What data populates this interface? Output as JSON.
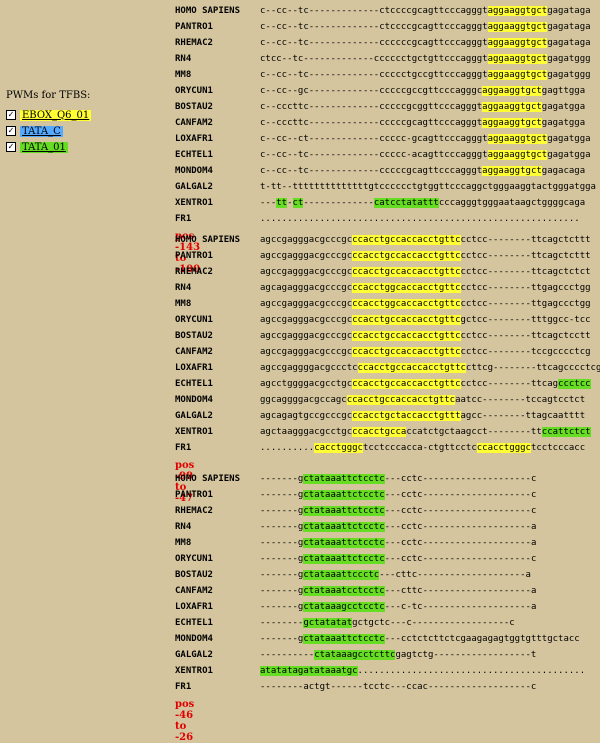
{
  "colors": {
    "background": "#d4c59e",
    "ebox": "#ffff33",
    "tata_c": "#55aaff",
    "tata_01": "#66dd22",
    "position_text": "#e00000"
  },
  "pwm_panel": {
    "title": "PWMs for TFBS:",
    "items": [
      {
        "label": "EBOX_Q6_01",
        "checked": true,
        "color": "#ffff33"
      },
      {
        "label": "TATA_C",
        "checked": true,
        "color": "#55aaff"
      },
      {
        "label": "TATA_01",
        "checked": true,
        "color": "#66dd22"
      }
    ]
  },
  "blocks": [
    {
      "rows": [
        {
          "species": "HOMO SAPIENS",
          "segs": [
            [
              "c--cc--tc-------------ctccccgcagttcccagggt",
              ""
            ],
            [
              "aggaaggtgct",
              "y"
            ],
            [
              "gagataga",
              ""
            ]
          ]
        },
        {
          "species": "PANTRO1",
          "segs": [
            [
              "c--cc--tc-------------ctccccgcagttcccagggt",
              ""
            ],
            [
              "aggaaggtgct",
              "y"
            ],
            [
              "gagataga",
              ""
            ]
          ]
        },
        {
          "species": "RHEMAC2",
          "segs": [
            [
              "c--cc--tc-------------ccccccgcagttcccagggt",
              ""
            ],
            [
              "aggaaggtgct",
              "y"
            ],
            [
              "gagataga",
              ""
            ]
          ]
        },
        {
          "species": "RN4",
          "segs": [
            [
              "ctcc--tc-------------cccccctgctgttcccagggt",
              ""
            ],
            [
              "aggaaggtgct",
              "y"
            ],
            [
              "gagatggg",
              ""
            ]
          ]
        },
        {
          "species": "MM8",
          "segs": [
            [
              "c--cc--tc-------------ccccctgccgttcccagggt",
              ""
            ],
            [
              "aggaaggtgct",
              "y"
            ],
            [
              "gagatggg",
              ""
            ]
          ]
        },
        {
          "species": "ORYCUN1",
          "segs": [
            [
              "c--cc--gc-------------cccccgccgttcccagggc",
              ""
            ],
            [
              "aggaaggtgct",
              "y"
            ],
            [
              "gagttgga",
              ""
            ]
          ]
        },
        {
          "species": "BOSTAU2",
          "segs": [
            [
              "c--cccttc-------------cccccgcggttcccagggt",
              ""
            ],
            [
              "aggaaggtgct",
              "y"
            ],
            [
              "gagatgga",
              ""
            ]
          ]
        },
        {
          "species": "CANFAM2",
          "segs": [
            [
              "c--cccttc-------------cccccgcagttcccagggt",
              ""
            ],
            [
              "aggaaggtgct",
              "y"
            ],
            [
              "gagatgga",
              ""
            ]
          ]
        },
        {
          "species": "LOXAFR1",
          "segs": [
            [
              "c--cc--ct-------------ccccc-gcagttcccagggt",
              ""
            ],
            [
              "aggaaggtgct",
              "y"
            ],
            [
              "gagatgga",
              ""
            ]
          ]
        },
        {
          "species": "ECHTEL1",
          "segs": [
            [
              "c--cc--tc-------------ccccc-acagttcccagggt",
              ""
            ],
            [
              "aggaaggtgct",
              "y"
            ],
            [
              "gagatgga",
              ""
            ]
          ]
        },
        {
          "species": "MONDOM4",
          "segs": [
            [
              "c--cc--tc-------------cccccgcagttcccagggt",
              ""
            ],
            [
              "aggaaggtgct",
              "y"
            ],
            [
              "gagacaga",
              ""
            ]
          ]
        },
        {
          "species": "GALGAL2",
          "segs": [
            [
              "t-tt--ttttttttttttttgtcccccctgtggttcccaggctgggaaggtactgggatgga",
              ""
            ]
          ]
        },
        {
          "species": "XENTRO1",
          "segs": [
            [
              "---",
              ""
            ],
            [
              "tt",
              "g"
            ],
            [
              "-",
              ""
            ],
            [
              "ct",
              "g"
            ],
            [
              "-------------",
              ""
            ],
            [
              "catcctatattt",
              "g"
            ],
            [
              "cccagggtgggaataagctggggcaga",
              ""
            ]
          ]
        },
        {
          "species": "FR1",
          "segs": [
            [
              "...........................................................",
              ""
            ]
          ]
        }
      ],
      "pos": "pos -143 to -100"
    },
    {
      "rows": [
        {
          "species": "HOMO SAPIENS",
          "segs": [
            [
              "agccgagggacgcccgc",
              ""
            ],
            [
              "ccacctgccaccacctgttc",
              "y"
            ],
            [
              "cctcc--------ttcagctcttt",
              ""
            ]
          ]
        },
        {
          "species": "PANTRO1",
          "segs": [
            [
              "agccgagggacgcccgc",
              ""
            ],
            [
              "ccacctgccaccacctgttc",
              "y"
            ],
            [
              "cctcc--------ttcagctcttt",
              ""
            ]
          ]
        },
        {
          "species": "RHEMAC2",
          "segs": [
            [
              "agccgagggacgcccgc",
              ""
            ],
            [
              "ccacctgccaccacctgttc",
              "y"
            ],
            [
              "cctcc--------ttcagctctct",
              ""
            ]
          ]
        },
        {
          "species": "RN4",
          "segs": [
            [
              "agcagagggacgcccgc",
              ""
            ],
            [
              "ccacctggcaccacctgttc",
              "y"
            ],
            [
              "cctcc--------ttgagccctgg",
              ""
            ]
          ]
        },
        {
          "species": "MM8",
          "segs": [
            [
              "agccgagggacgcccgc",
              ""
            ],
            [
              "ccacctggcaccacctgttc",
              "y"
            ],
            [
              "cctcc--------ttgagccctgg",
              ""
            ]
          ]
        },
        {
          "species": "ORYCUN1",
          "segs": [
            [
              "agccgagggacgcccgc",
              ""
            ],
            [
              "ccacctgccaccacctgttc",
              "y"
            ],
            [
              "gctcc--------tttggcc-tcc",
              ""
            ]
          ]
        },
        {
          "species": "BOSTAU2",
          "segs": [
            [
              "agccgagggacgcccgc",
              ""
            ],
            [
              "ccacctgccaccacctgttc",
              "y"
            ],
            [
              "cctcc--------ttcagctcctt",
              ""
            ]
          ]
        },
        {
          "species": "CANFAM2",
          "segs": [
            [
              "agccgagggacgcccgc",
              ""
            ],
            [
              "ccacctgccaccacctgttc",
              "y"
            ],
            [
              "cctcc--------tccgcccctcg",
              ""
            ]
          ]
        },
        {
          "species": "LOXAFR1",
          "segs": [
            [
              "agccgaggggacgccctc",
              ""
            ],
            [
              "ccacctgccaccacctgttc",
              "y"
            ],
            [
              "cttcg--------ttcagcccctcg",
              ""
            ]
          ]
        },
        {
          "species": "ECHTEL1",
          "segs": [
            [
              "agcctggggacgcctgc",
              ""
            ],
            [
              "ccacctgccaccacctgttc",
              "y"
            ],
            [
              "cctcc--------ttcag",
              ""
            ],
            [
              "ccctcc",
              "g"
            ]
          ]
        },
        {
          "species": "MONDOM4",
          "segs": [
            [
              "ggcaggggacgccagc",
              ""
            ],
            [
              "ccacctgccaccacctgttc",
              "y"
            ],
            [
              "aatcc--------tccagtcctct",
              ""
            ]
          ]
        },
        {
          "species": "GALGAL2",
          "segs": [
            [
              "agcagagtgccgcccgc",
              ""
            ],
            [
              "ccacctgctaccacctgttt",
              "y"
            ],
            [
              "agcc--------ttagcaatttt",
              ""
            ]
          ]
        },
        {
          "species": "XENTRO1",
          "segs": [
            [
              "agctaagggacgcctgc",
              ""
            ],
            [
              "ccacctgcca",
              "y"
            ],
            [
              "ccatctgctaagcct--------tt",
              ""
            ],
            [
              "ccattctct",
              "g"
            ]
          ]
        },
        {
          "species": "FR1",
          "segs": [
            [
              "..........",
              ""
            ],
            [
              "cacctgggc",
              "y"
            ],
            [
              "tcctcccacca-ctgttcctc",
              ""
            ],
            [
              "ccacctgggc",
              "y"
            ],
            [
              "tcctcccacc",
              ""
            ]
          ]
        }
      ],
      "pos": "pos -99 to -47"
    },
    {
      "rows": [
        {
          "species": "HOMO SAPIENS",
          "segs": [
            [
              "-------g",
              ""
            ],
            [
              "ctataaattctcctc",
              "g"
            ],
            [
              "---cctc--------------------c",
              ""
            ]
          ]
        },
        {
          "species": "PANTRO1",
          "segs": [
            [
              "-------g",
              ""
            ],
            [
              "ctataaattctcctc",
              "g"
            ],
            [
              "---cctc--------------------c",
              ""
            ]
          ]
        },
        {
          "species": "RHEMAC2",
          "segs": [
            [
              "-------g",
              ""
            ],
            [
              "ctataaattctcctc",
              "g"
            ],
            [
              "---cctc--------------------c",
              ""
            ]
          ]
        },
        {
          "species": "RN4",
          "segs": [
            [
              "-------g",
              ""
            ],
            [
              "ctataaattctcctc",
              "g"
            ],
            [
              "---cctc--------------------a",
              ""
            ]
          ]
        },
        {
          "species": "MM8",
          "segs": [
            [
              "-------g",
              ""
            ],
            [
              "ctataaattctcctc",
              "g"
            ],
            [
              "---cctc--------------------a",
              ""
            ]
          ]
        },
        {
          "species": "ORYCUN1",
          "segs": [
            [
              "-------g",
              ""
            ],
            [
              "ctataaattctcctc",
              "g"
            ],
            [
              "---cctc--------------------c",
              ""
            ]
          ]
        },
        {
          "species": "BOSTAU2",
          "segs": [
            [
              "-------g",
              ""
            ],
            [
              "ctataaattccctc",
              "g"
            ],
            [
              "---cttc--------------------a",
              ""
            ]
          ]
        },
        {
          "species": "CANFAM2",
          "segs": [
            [
              "-------g",
              ""
            ],
            [
              "ctataaatcctcctc",
              "g"
            ],
            [
              "---cttc--------------------a",
              ""
            ]
          ]
        },
        {
          "species": "LOXAFR1",
          "segs": [
            [
              "-------g",
              ""
            ],
            [
              "ctataaagcctcctc",
              "g"
            ],
            [
              "---c-tc--------------------a",
              ""
            ]
          ]
        },
        {
          "species": "ECHTEL1",
          "segs": [
            [
              "--------",
              ""
            ],
            [
              "gctatatat",
              "g"
            ],
            [
              "gctgctc---c------------------c",
              ""
            ]
          ]
        },
        {
          "species": "MONDOM4",
          "segs": [
            [
              "-------g",
              ""
            ],
            [
              "ctataaattctcctc",
              "g"
            ],
            [
              "---cctctcttctcgaagagagtggtgtttgctacc",
              ""
            ]
          ]
        },
        {
          "species": "GALGAL2",
          "segs": [
            [
              "----------",
              ""
            ],
            [
              "ctataaagcctcttc",
              "g"
            ],
            [
              "gagtctg------------------t",
              ""
            ]
          ]
        },
        {
          "species": "XENTRO1",
          "segs": [
            [
              "atatatagatataaatgc",
              "g"
            ],
            [
              "..........................................",
              ""
            ]
          ]
        },
        {
          "species": "FR1",
          "segs": [
            [
              "--------actgt------tcctc---ccac-------------------c",
              ""
            ]
          ]
        }
      ],
      "pos": "pos -46 to -26"
    }
  ]
}
